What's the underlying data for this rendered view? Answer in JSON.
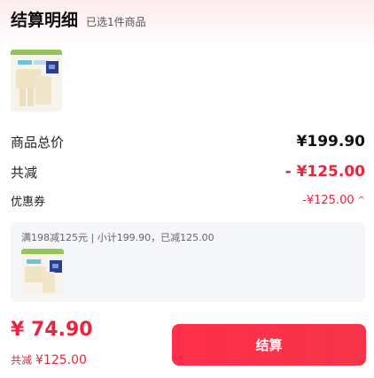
{
  "header": {
    "title": "结算明细",
    "subtitle": "已选1件商品"
  },
  "summary": {
    "total_label": "商品总价",
    "total_value": "¥199.90",
    "reduction_label": "共减",
    "reduction_value": "- ¥125.00",
    "coupon_label": "优惠券",
    "coupon_value": "-¥125.00",
    "coupon_chevron_icon": "chevron-up-icon"
  },
  "promo": {
    "text": "满198减125元 | 小计199.90，已减125.00"
  },
  "footer": {
    "pay_amount": "¥ 74.90",
    "discount_label": "共减",
    "discount_value": "¥125.00",
    "checkout_label": "结算"
  },
  "colors": {
    "accent": "#e8253e",
    "button": "#f5344a"
  }
}
